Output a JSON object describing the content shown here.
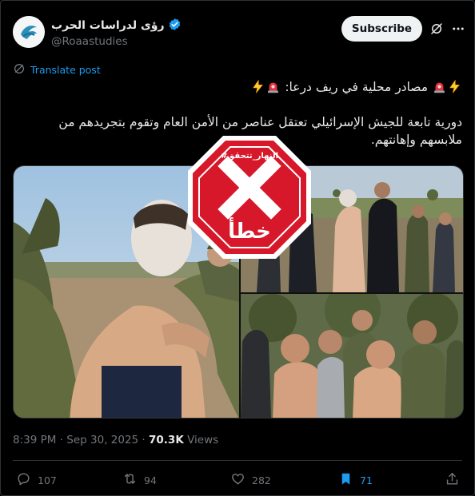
{
  "author": {
    "display_name": "رؤى لدراسات الحرب",
    "handle": "@Roaastudies",
    "verified": true
  },
  "header": {
    "subscribe_label": "Subscribe",
    "icons": [
      "grok-icon",
      "more-icon"
    ]
  },
  "translate_label": "Translate post",
  "post": {
    "line1": "مصادر محلية في ريف درعا:",
    "line2": "دورية تابعة للجيش الإسرائيلي تعتقل عناصر من  الأمن العام وتقوم بتجريدهم من",
    "line3": "ملابسهم وإهانتهم."
  },
  "media": {
    "stamp_brand": "#النهار_تتحقق",
    "stamp_verdict": "خطأ",
    "stamp_color": "#d7182a"
  },
  "meta": {
    "time": "8:39 PM",
    "sep": " · ",
    "date": "Sep 30, 2025",
    "views_count": "70.3K",
    "views_label": "Views"
  },
  "actions": {
    "replies": "107",
    "reposts": "94",
    "likes": "282",
    "bookmarks": "71",
    "bookmark_color": "#1d9bf0"
  }
}
